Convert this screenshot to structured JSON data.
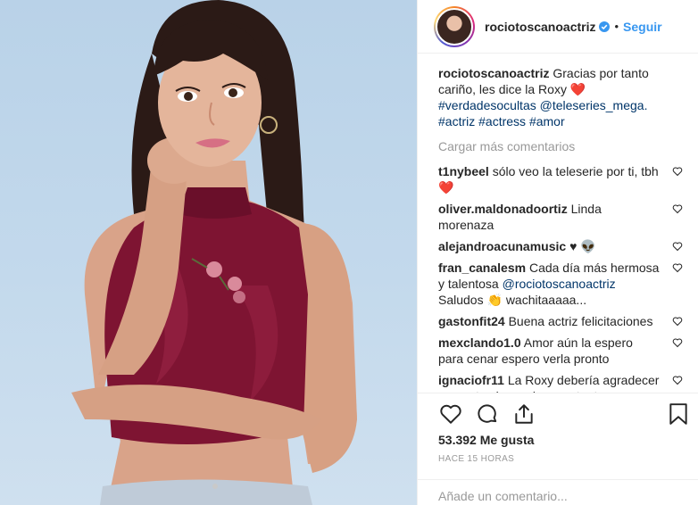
{
  "post": {
    "username": "rociotoscanoactriz",
    "follow_label": "Seguir",
    "separator": "•"
  },
  "caption": {
    "username": "rociotoscanoactriz",
    "text": "Gracias por tanto cariño, les dice la Roxy",
    "emoji": "❤️",
    "hashtag1": "#verdadesocultas",
    "mention": "@teleseries_mega.",
    "hashtag2": "#actriz",
    "hashtag3": "#actress",
    "hashtag4": "#amor"
  },
  "load_more": "Cargar más comentarios",
  "comments": [
    {
      "user": "t1nybeel",
      "text": "sólo veo la teleserie por ti, tbh",
      "emoji": "❤️"
    },
    {
      "user": "oliver.maldonadoortiz",
      "text": "Linda morenaza",
      "emoji": ""
    },
    {
      "user": "alejandroacunamusic",
      "text": "♥",
      "emoji": "👽"
    },
    {
      "user": "fran_canalesm",
      "text": "Cada día más hermosa y talentosa",
      "mention": "@rociotoscanoactriz",
      "text2": "Saludos",
      "emoji": "👏",
      "text3": "wachitaaaaa..."
    },
    {
      "user": "gastonfit24",
      "text": "Buena actriz felicitaciones",
      "emoji": ""
    },
    {
      "user": "mexclando1.0",
      "text": "Amor aún la espero para cenar espero verla pronto",
      "emoji": ""
    },
    {
      "user": "ignaciofr11",
      "text": "La Roxy debería agradecer que esta viva mejor, con tanto weon que muere entre los 3 y los 4 jaja",
      "emoji": "👏"
    }
  ],
  "likes": "53.392 Me gusta",
  "timestamp": "HACE 15 HORAS",
  "add_comment_placeholder": "Añade un comentario...",
  "colors": {
    "accent": "#3897f0",
    "hashtag": "#003569",
    "muted": "#999999",
    "heart": "#ed4956"
  },
  "icons": [
    "verified-icon",
    "heart-icon",
    "comment-icon",
    "share-icon",
    "bookmark-icon",
    "comment-like-icon"
  ]
}
